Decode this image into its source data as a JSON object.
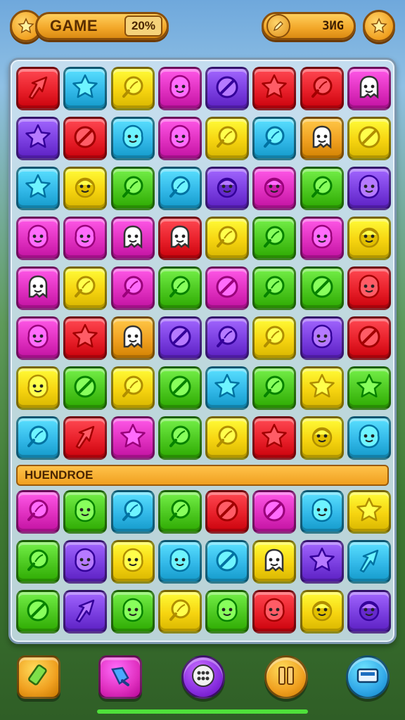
{
  "header": {
    "left_button_icon": "star-icon",
    "title": "GAME",
    "percent": "20%",
    "score_icon": "pencil-icon",
    "score": "3ИG",
    "right_button_icon": "star-icon"
  },
  "board": {
    "top_rows": [
      [
        {
          "color": "#e8202a",
          "icon": "arrow"
        },
        {
          "color": "#32b8e8",
          "icon": "star"
        },
        {
          "color": "#f6d410",
          "icon": "leaf"
        },
        {
          "color": "#e030c0",
          "icon": "blob"
        },
        {
          "color": "#7a3ee0",
          "icon": "pencil"
        },
        {
          "color": "#e8202a",
          "icon": "star"
        },
        {
          "color": "#e8202a",
          "icon": "leaf"
        },
        {
          "color": "#e030c0",
          "icon": "ghost"
        }
      ],
      [
        {
          "color": "#7a3ee0",
          "icon": "star"
        },
        {
          "color": "#e8202a",
          "icon": "pencil"
        },
        {
          "color": "#32b8e8",
          "icon": "blob"
        },
        {
          "color": "#e030c0",
          "icon": "blob"
        },
        {
          "color": "#f6d410",
          "icon": "leaf"
        },
        {
          "color": "#32b8e8",
          "icon": "leaf"
        },
        {
          "color": "#f0a020",
          "icon": "ghost"
        },
        {
          "color": "#f6d410",
          "icon": "pencil"
        }
      ],
      [
        {
          "color": "#32b8e8",
          "icon": "star"
        },
        {
          "color": "#f6d410",
          "icon": "face"
        },
        {
          "color": "#4cc820",
          "icon": "leaf"
        },
        {
          "color": "#32b8e8",
          "icon": "leaf"
        },
        {
          "color": "#7a3ee0",
          "icon": "face"
        },
        {
          "color": "#e030c0",
          "icon": "face"
        },
        {
          "color": "#4cc820",
          "icon": "leaf"
        },
        {
          "color": "#7a3ee0",
          "icon": "blob"
        }
      ],
      [
        {
          "color": "#e030c0",
          "icon": "blob"
        },
        {
          "color": "#e030c0",
          "icon": "blob"
        },
        {
          "color": "#e030c0",
          "icon": "ghost"
        },
        {
          "color": "#e8202a",
          "icon": "ghost"
        },
        {
          "color": "#f6d410",
          "icon": "leaf"
        },
        {
          "color": "#4cc820",
          "icon": "leaf"
        },
        {
          "color": "#e030c0",
          "icon": "blob"
        },
        {
          "color": "#f6d410",
          "icon": "face"
        }
      ],
      [
        {
          "color": "#e030c0",
          "icon": "ghost"
        },
        {
          "color": "#f6d410",
          "icon": "leaf"
        },
        {
          "color": "#e030c0",
          "icon": "leaf"
        },
        {
          "color": "#4cc820",
          "icon": "leaf"
        },
        {
          "color": "#e030c0",
          "icon": "pencil"
        },
        {
          "color": "#4cc820",
          "icon": "leaf"
        },
        {
          "color": "#4cc820",
          "icon": "pencil"
        },
        {
          "color": "#e8202a",
          "icon": "blob"
        }
      ],
      [
        {
          "color": "#e030c0",
          "icon": "blob"
        },
        {
          "color": "#e8202a",
          "icon": "star"
        },
        {
          "color": "#f0a020",
          "icon": "ghost"
        },
        {
          "color": "#7a3ee0",
          "icon": "pencil"
        },
        {
          "color": "#7a3ee0",
          "icon": "leaf"
        },
        {
          "color": "#f6d410",
          "icon": "leaf"
        },
        {
          "color": "#7a3ee0",
          "icon": "blob"
        },
        {
          "color": "#e8202a",
          "icon": "pencil"
        }
      ],
      [
        {
          "color": "#f6d410",
          "icon": "blob"
        },
        {
          "color": "#4cc820",
          "icon": "pencil"
        },
        {
          "color": "#f6d410",
          "icon": "leaf"
        },
        {
          "color": "#4cc820",
          "icon": "pencil"
        },
        {
          "color": "#32b8e8",
          "icon": "star"
        },
        {
          "color": "#4cc820",
          "icon": "leaf"
        },
        {
          "color": "#f6d410",
          "icon": "star"
        },
        {
          "color": "#4cc820",
          "icon": "star"
        }
      ],
      [
        {
          "color": "#32b8e8",
          "icon": "leaf"
        },
        {
          "color": "#e8202a",
          "icon": "arrow"
        },
        {
          "color": "#e030c0",
          "icon": "star"
        },
        {
          "color": "#4cc820",
          "icon": "leaf"
        },
        {
          "color": "#f6d410",
          "icon": "leaf"
        },
        {
          "color": "#e8202a",
          "icon": "star"
        },
        {
          "color": "#f6d410",
          "icon": "face"
        },
        {
          "color": "#32b8e8",
          "icon": "blob"
        }
      ]
    ],
    "divider_label": "HUENDROE",
    "bottom_rows": [
      [
        {
          "color": "#e030c0",
          "icon": "leaf"
        },
        {
          "color": "#4cc820",
          "icon": "blob"
        },
        {
          "color": "#32b8e8",
          "icon": "leaf"
        },
        {
          "color": "#4cc820",
          "icon": "leaf"
        },
        {
          "color": "#e8202a",
          "icon": "pencil"
        },
        {
          "color": "#e030c0",
          "icon": "pencil"
        },
        {
          "color": "#32b8e8",
          "icon": "blob"
        },
        {
          "color": "#f6d410",
          "icon": "star"
        }
      ],
      [
        {
          "color": "#4cc820",
          "icon": "leaf"
        },
        {
          "color": "#7a3ee0",
          "icon": "blob"
        },
        {
          "color": "#f6d410",
          "icon": "blob"
        },
        {
          "color": "#32b8e8",
          "icon": "blob"
        },
        {
          "color": "#32b8e8",
          "icon": "pencil"
        },
        {
          "color": "#f6d410",
          "icon": "ghost"
        },
        {
          "color": "#7a3ee0",
          "icon": "star"
        },
        {
          "color": "#32b8e8",
          "icon": "arrow"
        }
      ],
      [
        {
          "color": "#4cc820",
          "icon": "pencil"
        },
        {
          "color": "#7a3ee0",
          "icon": "arrow"
        },
        {
          "color": "#4cc820",
          "icon": "blob"
        },
        {
          "color": "#f6d410",
          "icon": "leaf"
        },
        {
          "color": "#4cc820",
          "icon": "blob"
        },
        {
          "color": "#e8202a",
          "icon": "blob"
        },
        {
          "color": "#f6d410",
          "icon": "face"
        },
        {
          "color": "#7a3ee0",
          "icon": "face"
        }
      ]
    ]
  },
  "toolbar": [
    {
      "name": "eraser-tool-button",
      "icon": "eraser-icon",
      "color": "#f0a020",
      "shape": "square"
    },
    {
      "name": "brush-tool-button",
      "icon": "brush-icon",
      "color": "#e030c0",
      "shape": "square"
    },
    {
      "name": "menu-dots-button",
      "icon": "dots-icon",
      "color": "#8a30e0",
      "shape": "circle"
    },
    {
      "name": "pause-button",
      "icon": "pause-icon",
      "color": "#f0a020",
      "shape": "circle"
    },
    {
      "name": "message-button",
      "icon": "envelope-icon",
      "color": "#32a8e8",
      "shape": "circle"
    }
  ]
}
